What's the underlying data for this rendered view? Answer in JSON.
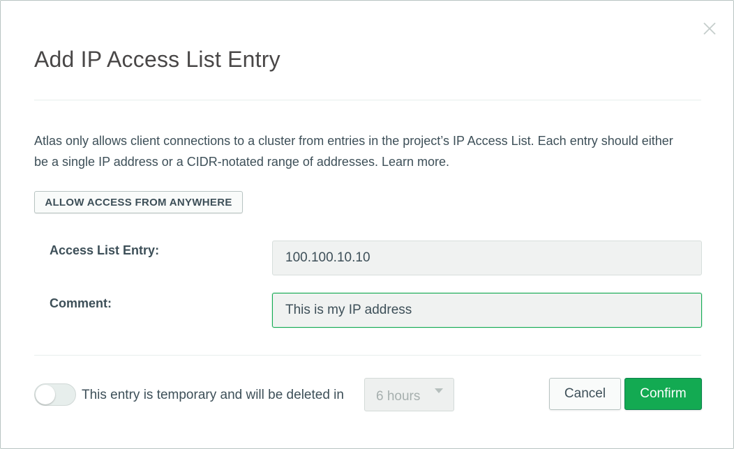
{
  "modal": {
    "title": "Add IP Access List Entry",
    "close_icon": "close-icon",
    "description": "Atlas only allows client connections to a cluster from entries in the project’s IP Access List. Each entry should either be a single IP address or a CIDR-notated range of addresses.",
    "learn_more": "Learn more."
  },
  "actions": {
    "allow_anywhere_label": "ALLOW ACCESS FROM ANYWHERE",
    "cancel_label": "Cancel",
    "confirm_label": "Confirm"
  },
  "form": {
    "entry_label": "Access List Entry:",
    "entry_value": "100.100.10.10",
    "comment_label": "Comment:",
    "comment_value": "This is my IP address"
  },
  "temporary": {
    "enabled": false,
    "text": "This entry is temporary and will be deleted in",
    "duration_selected": "6 hours",
    "arrow_icon": "caret-down-icon"
  },
  "colors": {
    "accent_green": "#13aa52",
    "text": "#3d4f58",
    "muted_text": "#a6afae"
  }
}
